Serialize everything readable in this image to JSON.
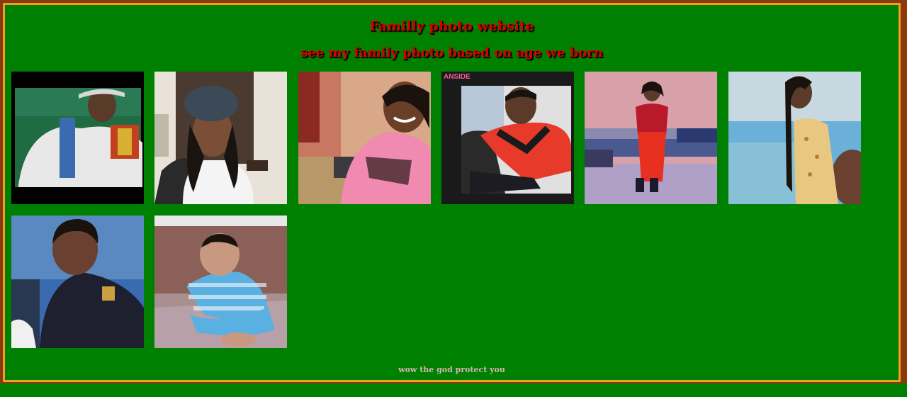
{
  "page": {
    "title": "Familly photo website",
    "subtitle": "see my family photo based on age we born",
    "footer": "wow the god protect you"
  },
  "photos": [
    {
      "description": "elderly man in traditional white clothing"
    },
    {
      "description": "woman in knit hat selfie"
    },
    {
      "description": "smiling woman in pink shirt selfie"
    },
    {
      "description": "young man in red shirt",
      "overlay_text": "ANSIDE"
    },
    {
      "description": "woman in red dress standing"
    },
    {
      "description": "woman in yellow dress against blue wall"
    },
    {
      "description": "young boy in dark jacket"
    },
    {
      "description": "baby in striped shirt sitting"
    }
  ],
  "colors": {
    "background": "#008000",
    "border": "#f0a020",
    "outer": "#8b3a10",
    "heading": "#d40000"
  }
}
